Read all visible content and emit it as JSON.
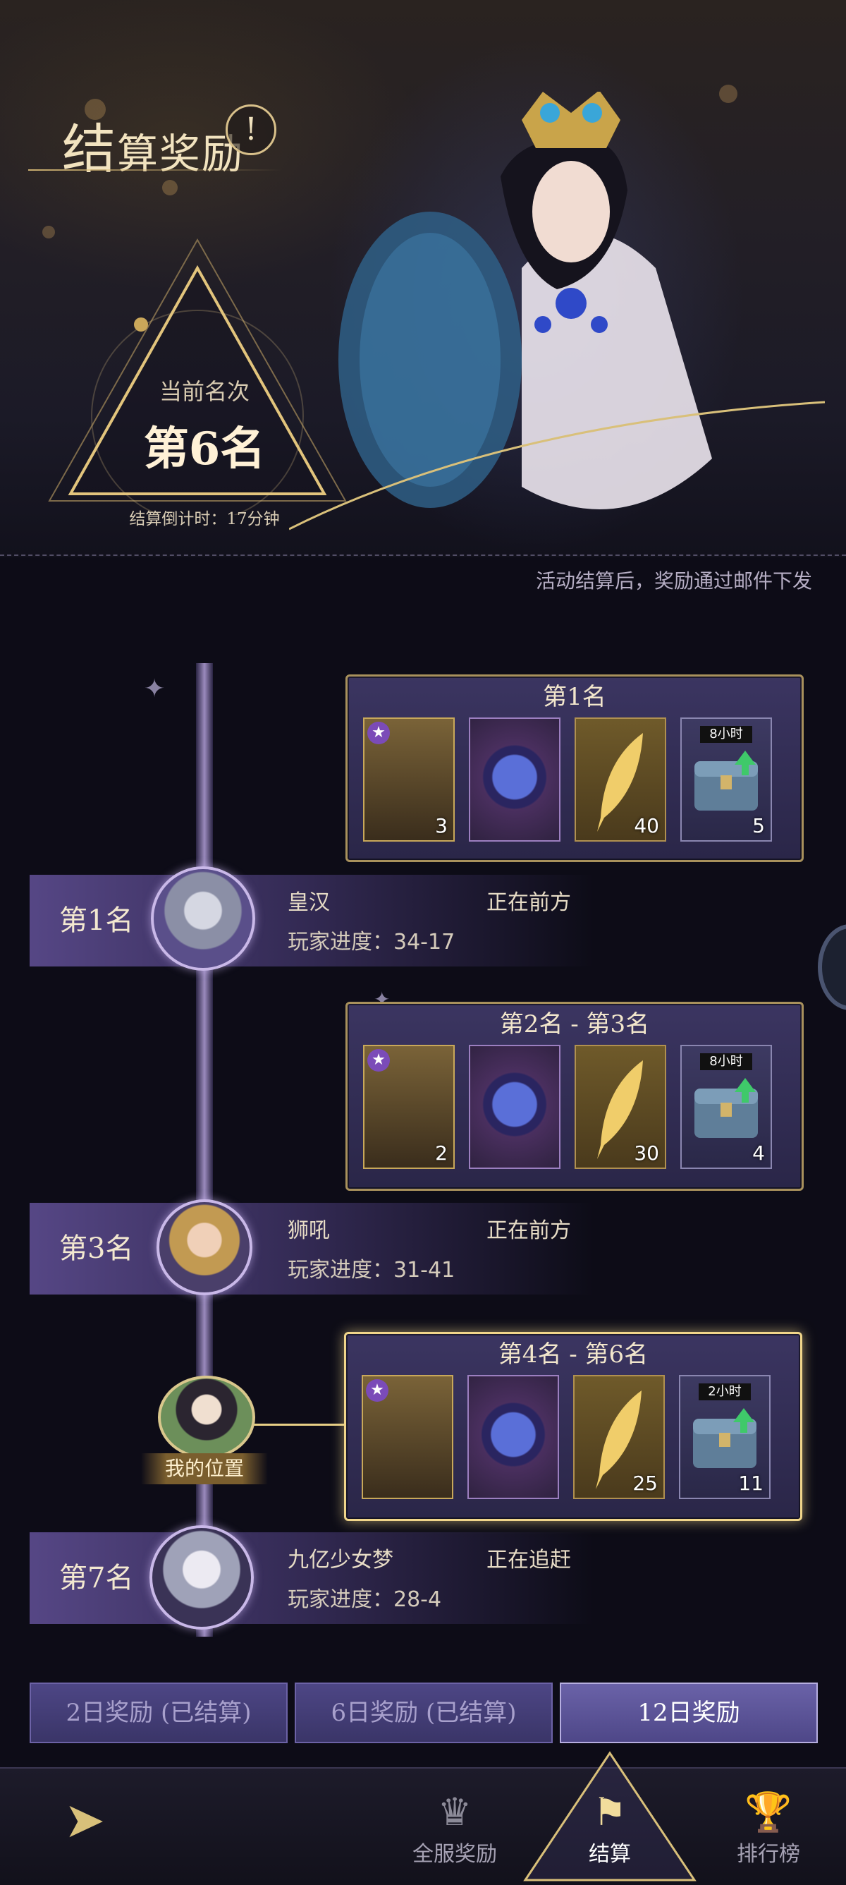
{
  "header": {
    "title_first_char": "结",
    "title_rest": "算奖励",
    "info_icon": "exclamation-icon",
    "rank_label": "当前名次",
    "rank_value": "第6名",
    "countdown": "结算倒计时：17分钟",
    "mail_note": "活动结算后，奖励通过邮件下发"
  },
  "reward_tiers": [
    {
      "title": "第1名",
      "items": [
        {
          "icon": "hero-portrait-icon",
          "qty": "3"
        },
        {
          "icon": "crystal-orb-icon",
          "qty": ""
        },
        {
          "icon": "golden-feather-icon",
          "qty": "40"
        },
        {
          "icon": "treasure-chest-icon",
          "tag": "8小时",
          "qty": "5"
        }
      ]
    },
    {
      "title": "第2名 - 第3名",
      "items": [
        {
          "icon": "hero-portrait-icon",
          "qty": "2"
        },
        {
          "icon": "crystal-orb-icon",
          "qty": ""
        },
        {
          "icon": "golden-feather-icon",
          "qty": "30"
        },
        {
          "icon": "treasure-chest-icon",
          "tag": "8小时",
          "qty": "4"
        }
      ]
    },
    {
      "title": "第4名 - 第6名",
      "items": [
        {
          "icon": "hero-portrait-icon",
          "qty": ""
        },
        {
          "icon": "crystal-orb-icon",
          "qty": ""
        },
        {
          "icon": "golden-feather-icon",
          "qty": "25"
        },
        {
          "icon": "treasure-chest-icon",
          "tag": "2小时",
          "qty": "11"
        }
      ]
    }
  ],
  "ranks": [
    {
      "rank": "第1名",
      "player": "皇汉",
      "status": "正在前方",
      "progress": "玩家进度：34-17"
    },
    {
      "rank": "第3名",
      "player": "狮吼",
      "status": "正在前方",
      "progress": "玩家进度：31-41"
    },
    {
      "rank": "第7名",
      "player": "九亿少女梦",
      "status": "正在追赶",
      "progress": "玩家进度：28-4"
    }
  ],
  "my_position_label": "我的位置",
  "day_tabs": [
    "2日奖励 (已结算)",
    "6日奖励 (已结算)",
    "12日奖励"
  ],
  "nav": [
    {
      "label": "",
      "icon": "back-arrow-icon"
    },
    {
      "label": "全服奖励",
      "icon": "crown-chest-icon"
    },
    {
      "label": "结算",
      "icon": "settlement-banner-icon"
    },
    {
      "label": "排行榜",
      "icon": "trophy-icon"
    }
  ],
  "colors": {
    "gold": "#e7cf85",
    "panel": "#3b3561",
    "background": "#0d0c17"
  }
}
